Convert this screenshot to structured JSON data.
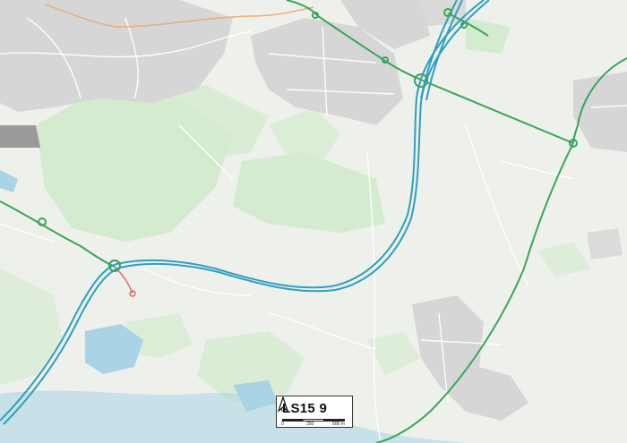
{
  "map": {
    "postcode_label": "LS15 9",
    "north_label": "N",
    "scale": {
      "ticks": [
        "0",
        "250",
        "500 m"
      ]
    },
    "colors": {
      "background": "#eef0ec",
      "built_up": "#d6d6d6",
      "green_space": "#d4ebcf",
      "water": "#aad3e6",
      "motorway": "#2f9fbf",
      "a_road": "#3aa55a",
      "minor_road": "#ffffff",
      "b_road": "#e8b07a",
      "local_road": "#f4d39a"
    }
  }
}
